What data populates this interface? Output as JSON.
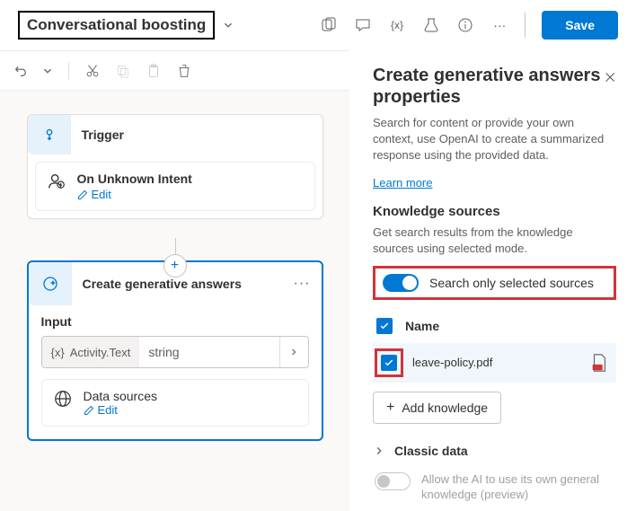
{
  "header": {
    "title": "Conversational boosting",
    "save": "Save"
  },
  "canvas": {
    "trigger_label": "Trigger",
    "on_unknown": "On Unknown Intent",
    "edit": "Edit",
    "gen_title": "Create generative answers",
    "input_label": "Input",
    "activity_text": "Activity.Text",
    "string": "string",
    "data_sources": "Data sources"
  },
  "panel": {
    "title": "Create generative answers properties",
    "desc": "Search for content or provide your own context, use OpenAI to create a summarized response using the provided data.",
    "learn_more": "Learn more",
    "ks_title": "Knowledge sources",
    "ks_desc": "Get search results from the knowledge sources using selected mode.",
    "search_only": "Search only selected sources",
    "name_col": "Name",
    "file": "leave-policy.pdf",
    "add_knowledge": "Add knowledge",
    "classic": "Classic data",
    "allow_ai": "Allow the AI to use its own general knowledge (preview)"
  }
}
